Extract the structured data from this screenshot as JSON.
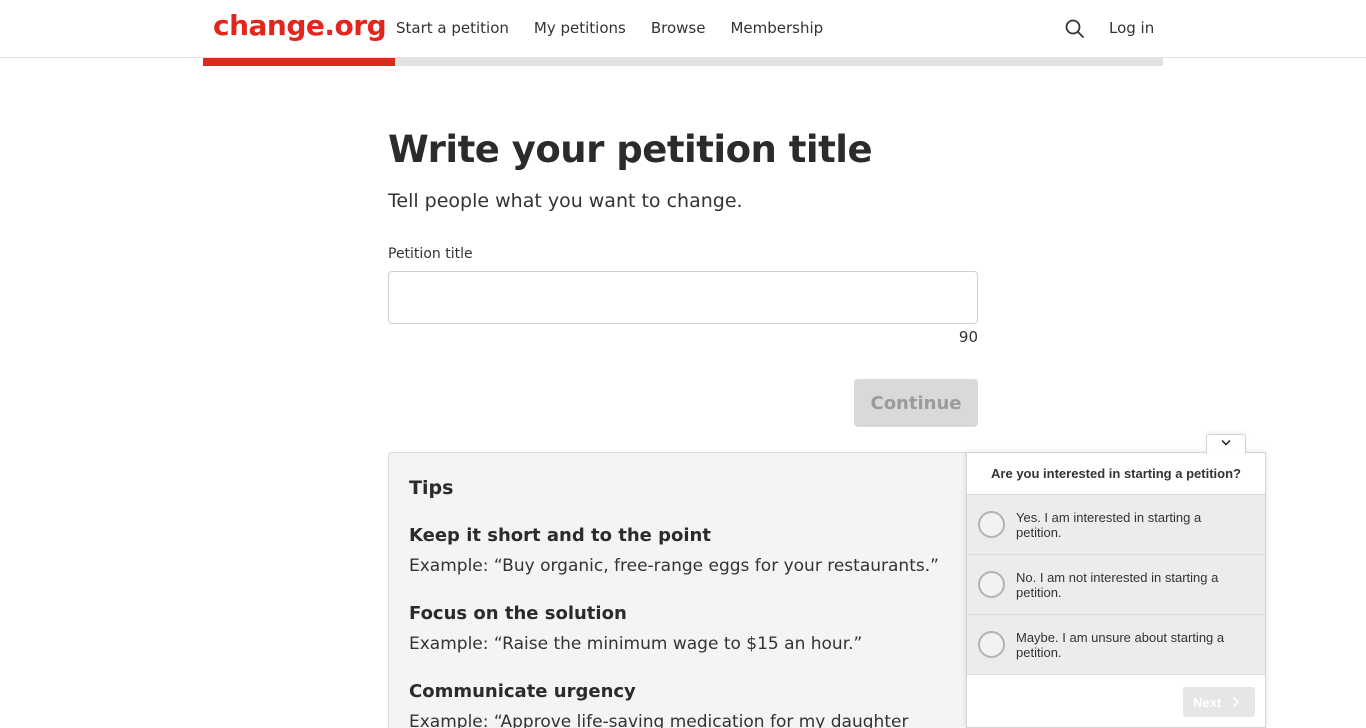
{
  "header": {
    "logo": "change.org",
    "nav": [
      "Start a petition",
      "My petitions",
      "Browse",
      "Membership"
    ],
    "login": "Log in",
    "search_icon": "search-icon"
  },
  "progress": {
    "fraction": 0.2
  },
  "form": {
    "title": "Write your petition title",
    "subtitle": "Tell people what you want to change.",
    "field_label": "Petition title",
    "field_value": "",
    "char_count": "90",
    "continue_label": "Continue"
  },
  "tips": {
    "heading": "Tips",
    "items": [
      {
        "title": "Keep it short and to the point",
        "text": "Example: “Buy organic, free-range eggs for your restaurants.”"
      },
      {
        "title": "Focus on the solution",
        "text": "Example: “Raise the minimum wage to $15 an hour.”"
      },
      {
        "title": "Communicate urgency",
        "text": "Example: “Approve life-saving medication for my daughter"
      }
    ]
  },
  "survey": {
    "collapse_icon": "chevron-down-icon",
    "question": "Are you interested in starting a petition?",
    "options": [
      "Yes. I am interested in starting a petition.",
      "No. I am not interested in starting a petition.",
      "Maybe. I am unsure about starting a petition."
    ],
    "next_label": "Next"
  },
  "colors": {
    "brand": "#e3261d",
    "progress_track": "#e1e1e1",
    "disabled_button": "#d9d9d9"
  }
}
